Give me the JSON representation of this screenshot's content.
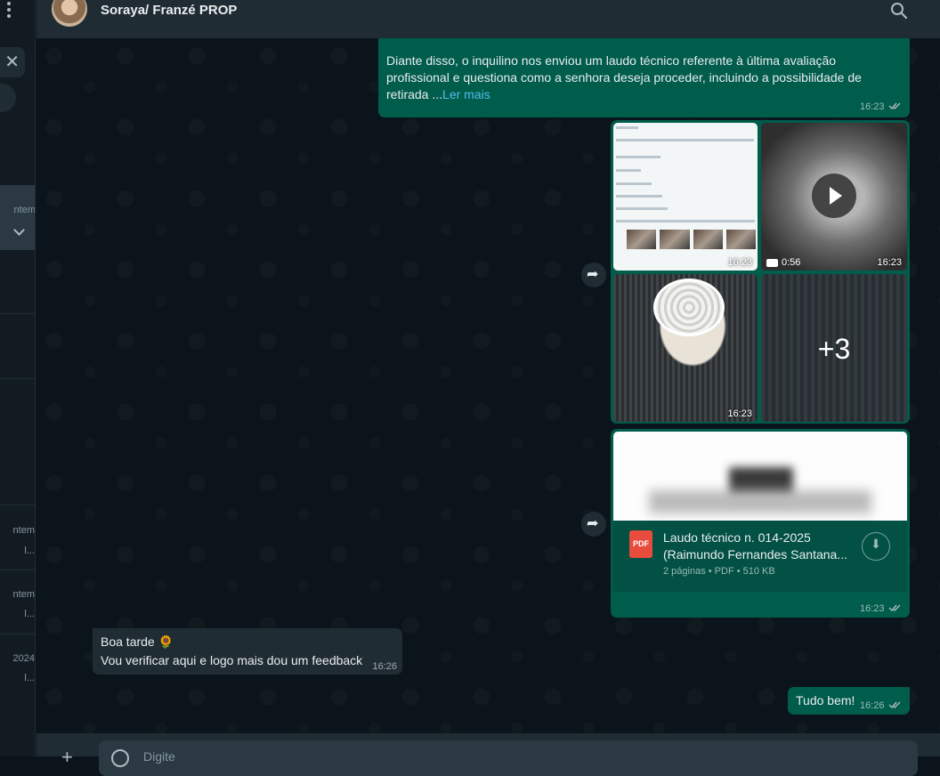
{
  "sidebar": {
    "active_item_text": "ntem",
    "items": [
      {
        "line1": "ntem",
        "line2": "l..."
      },
      {
        "line1": "ntem",
        "line2": "l..."
      },
      {
        "line1": "2024",
        "line2": "l..."
      }
    ]
  },
  "header": {
    "contact_name": "Soraya/ Franzé PROP"
  },
  "messages": {
    "msg1": {
      "text": "Diante disso, o inquilino nos enviou um laudo técnico referente à última avaliação profissional e questiona como a senhora deseja proceder, incluindo a possibilidade de retirada ...",
      "read_more": "Ler mais",
      "time": "16:23"
    },
    "media": {
      "tile1_time": "16:23",
      "tile2_duration": "0:56",
      "tile2_time": "16:23",
      "tile3_time": "16:23",
      "tile4_more": "+3"
    },
    "doc": {
      "icon_label": "PDF",
      "title": "Laudo técnico n. 014-2025 (Raimundo Fernandes Santana...",
      "meta": "2 páginas • PDF • 510 KB",
      "time": "16:23"
    },
    "incoming": {
      "line1": "Boa tarde 🌻",
      "line2": "Vou verificar aqui e logo mais dou um feedback",
      "time": "16:26"
    },
    "out2": {
      "text": "Tudo bem!",
      "time": "16:26"
    }
  },
  "composer": {
    "placeholder": "Digite"
  },
  "colors": {
    "outgoing_bubble": "#005c4b",
    "incoming_bubble": "#202c33",
    "link": "#53bdeb",
    "pdf_red": "#e74c3c"
  }
}
